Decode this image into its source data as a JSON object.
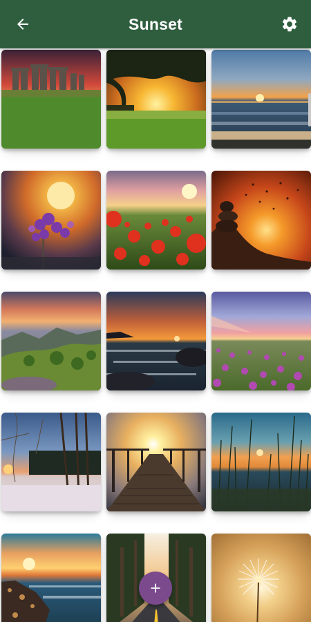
{
  "appbar": {
    "title": "Sunset",
    "back_icon": "arrow-left-icon",
    "settings_icon": "gear-icon",
    "color": "#2f5e3f"
  },
  "gallery": {
    "columns": 3,
    "wallpapers": [
      "stonehenge-sunset",
      "tree-over-field-sunset",
      "ocean-horizon-sunset",
      "purple-flowers-sun",
      "red-poppies-sunset",
      "rock-cairn-birds-sunset",
      "mountain-valley-sunset",
      "rocky-coast-sunset",
      "lavender-field-sunset",
      "winter-birches-sunset",
      "wooden-pier-sunset",
      "reeds-lake-sunset",
      "rocky-shore-sunset",
      "forest-road-sunset",
      "dandelion-sunset"
    ]
  },
  "fab": {
    "icon": "plus-icon",
    "color": "#7b4a8d"
  }
}
